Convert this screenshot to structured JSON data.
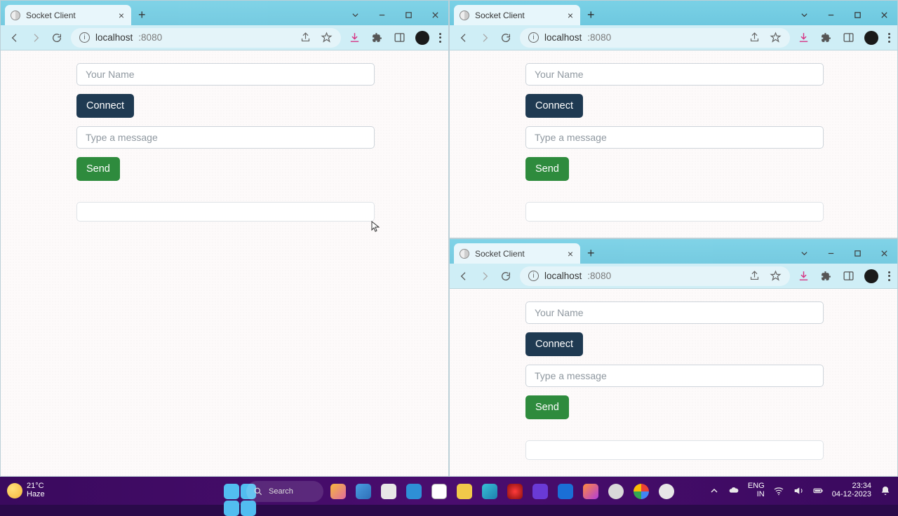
{
  "windows": {
    "w1": {
      "tab_title": "Socket Client",
      "url_host": "localhost",
      "url_port": ":8080"
    },
    "w2": {
      "tab_title": "Socket Client",
      "url_host": "localhost",
      "url_port": ":8080"
    },
    "w3": {
      "tab_title": "Socket Client",
      "url_host": "localhost",
      "url_port": ":8080"
    }
  },
  "app": {
    "name_placeholder": "Your Name",
    "connect_label": "Connect",
    "message_placeholder": "Type a message",
    "send_label": "Send"
  },
  "taskbar": {
    "weather_temp": "21°C",
    "weather_desc": "Haze",
    "search_placeholder": "Search",
    "lang_line1": "ENG",
    "lang_line2": "IN",
    "time": "23:34",
    "date": "04-12-2023"
  }
}
